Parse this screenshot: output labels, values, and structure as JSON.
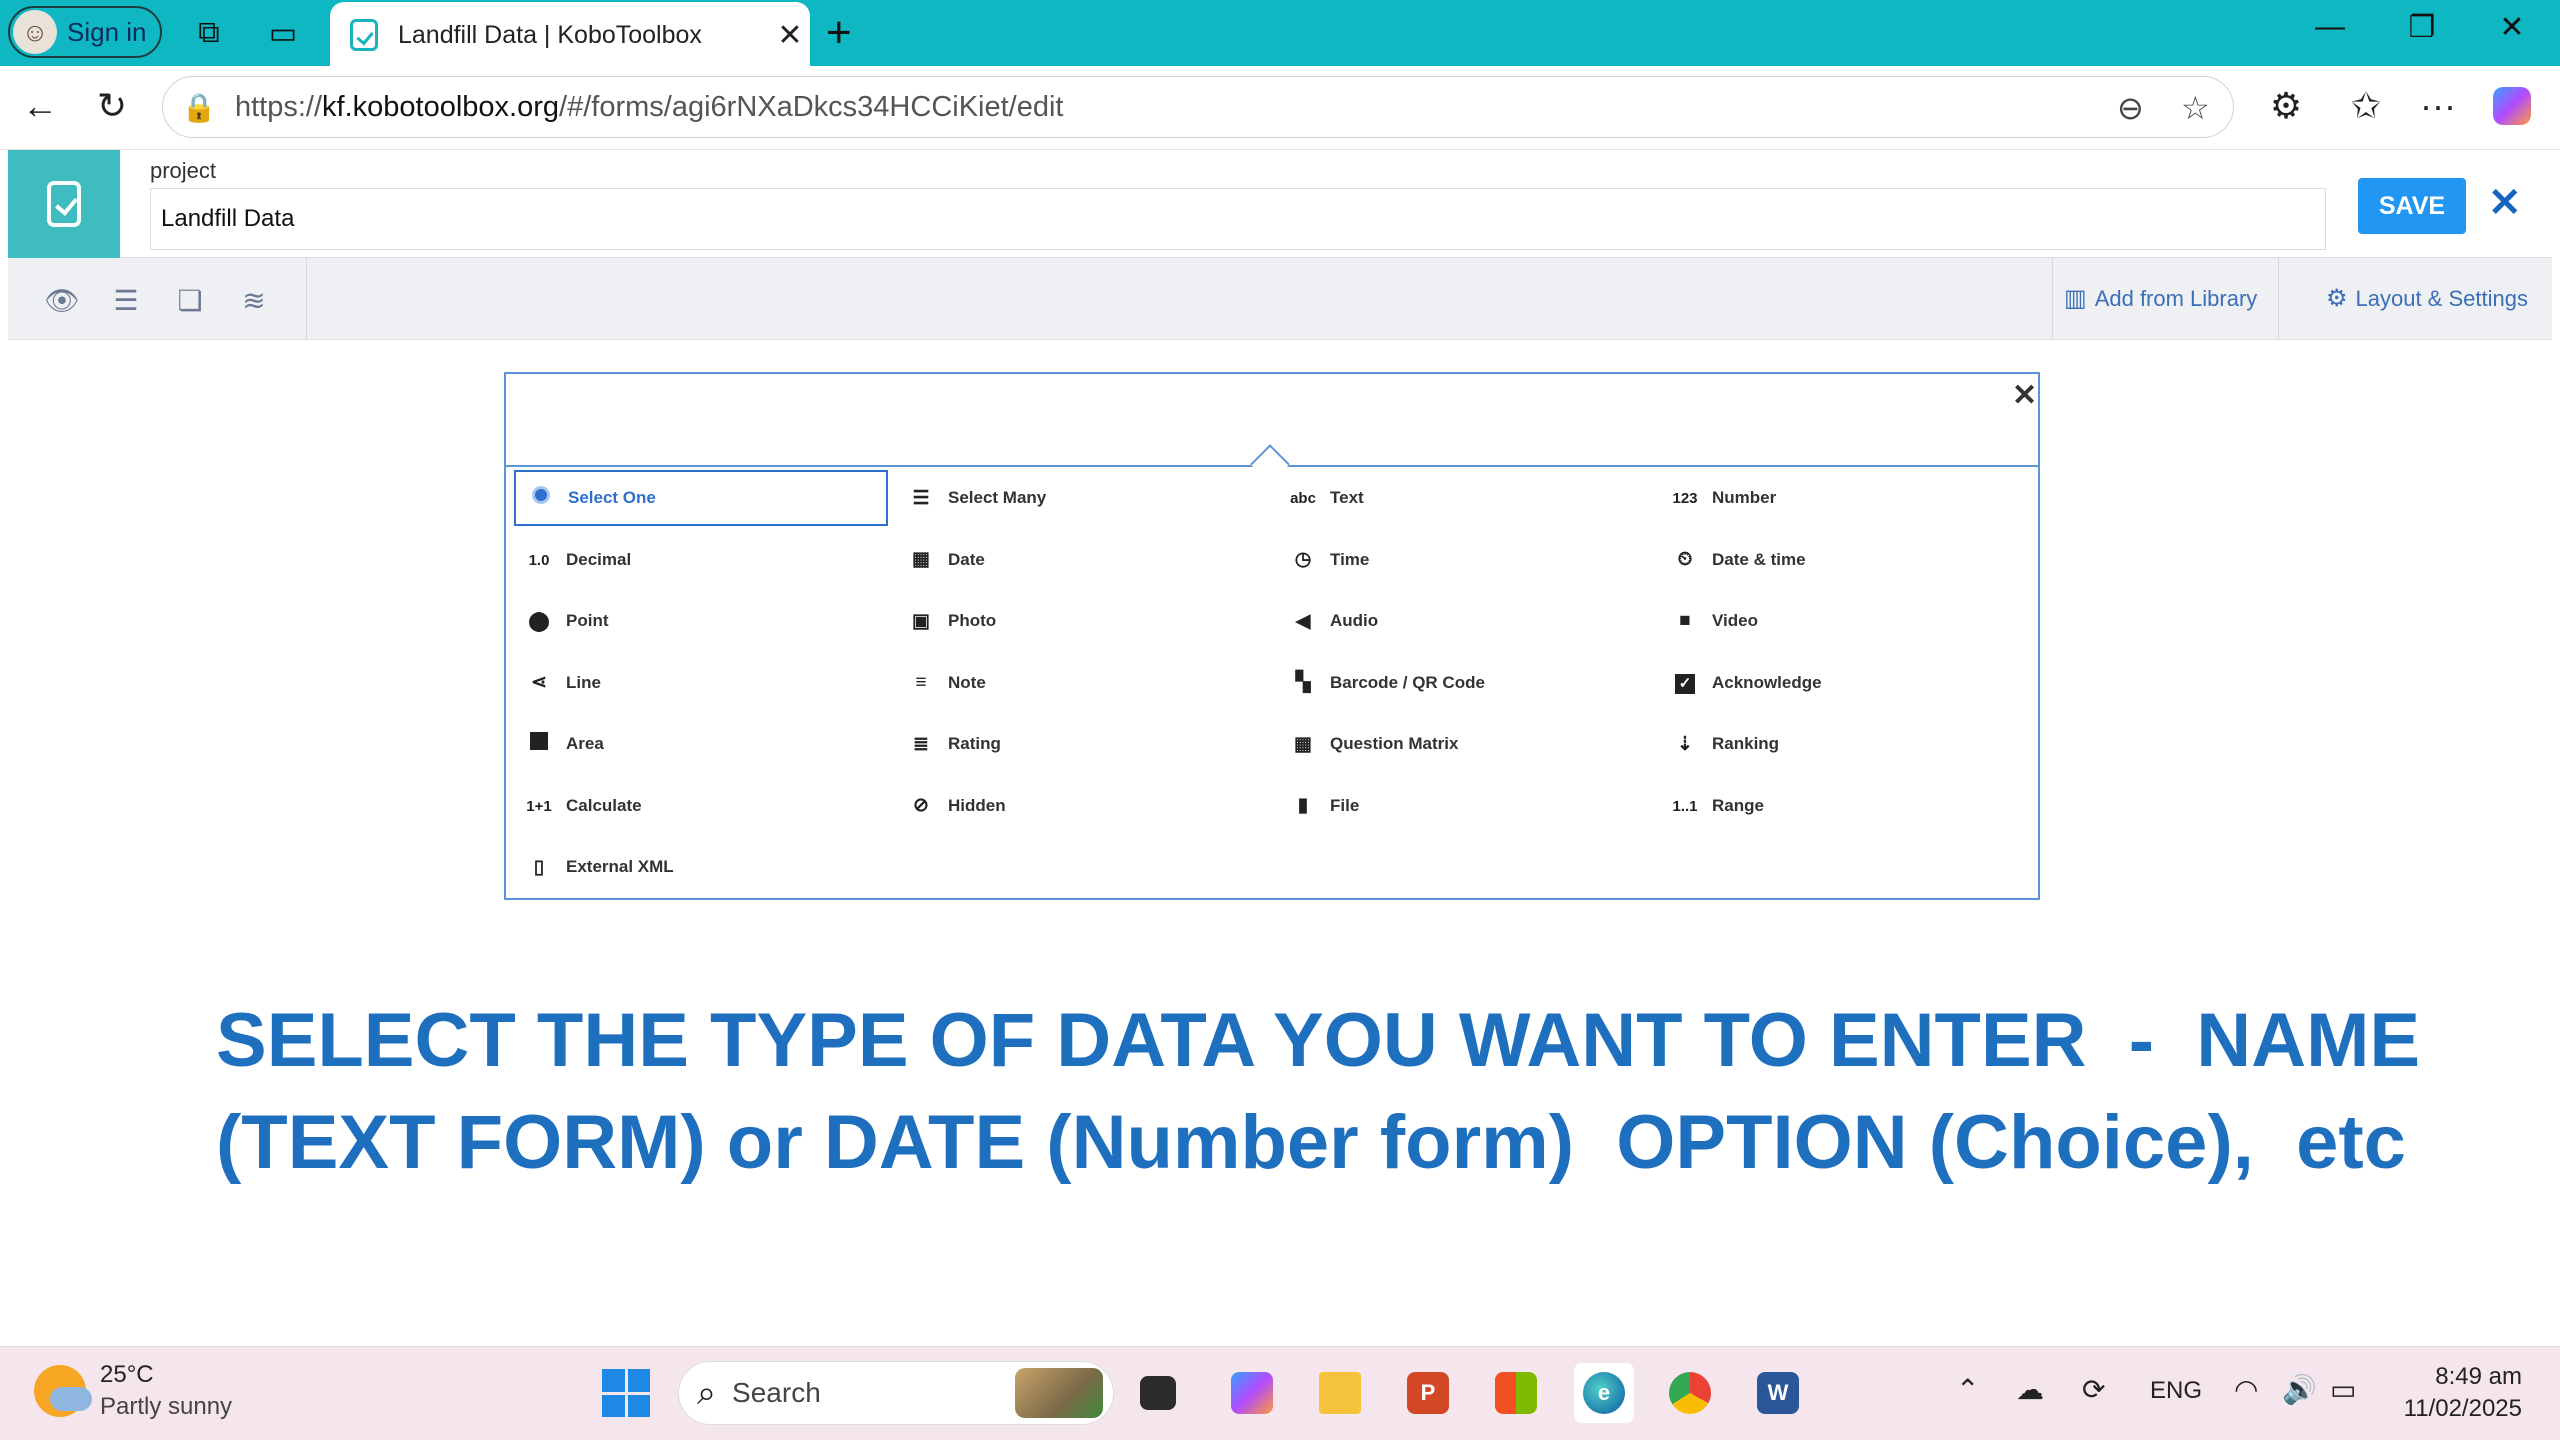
{
  "browser": {
    "profile_label": "Sign in",
    "tab_title": "Landfill Data | KoboToolbox",
    "url_scheme": "https://",
    "url_host": "kf.kobotoolbox.org",
    "url_path": "/#/forms/agi6rNXaDkcs34HCCiKiet/edit"
  },
  "kobo": {
    "project_label": "project",
    "project_name": "Landfill Data",
    "save_label": "SAVE",
    "add_library_label": "Add from Library",
    "layout_settings_label": "Layout & Settings"
  },
  "picker": {
    "types": [
      {
        "label": "Select One",
        "icon": "radio-icon"
      },
      {
        "label": "Select Many",
        "icon": "list-icon"
      },
      {
        "label": "Text",
        "icon": "abc"
      },
      {
        "label": "Number",
        "icon": "123"
      },
      {
        "label": "Decimal",
        "icon": "1.0"
      },
      {
        "label": "Date",
        "icon": "calendar-icon"
      },
      {
        "label": "Time",
        "icon": "clock-icon"
      },
      {
        "label": "Date & time",
        "icon": "datetime-icon"
      },
      {
        "label": "Point",
        "icon": "pin-icon"
      },
      {
        "label": "Photo",
        "icon": "photo-icon"
      },
      {
        "label": "Audio",
        "icon": "speaker-icon"
      },
      {
        "label": "Video",
        "icon": "video-icon"
      },
      {
        "label": "Line",
        "icon": "share-icon"
      },
      {
        "label": "Note",
        "icon": "lines-icon"
      },
      {
        "label": "Barcode / QR Code",
        "icon": "qr-icon"
      },
      {
        "label": "Acknowledge",
        "icon": "checkbox-icon"
      },
      {
        "label": "Area",
        "icon": "square-icon"
      },
      {
        "label": "Rating",
        "icon": "rating-icon"
      },
      {
        "label": "Question Matrix",
        "icon": "table-icon"
      },
      {
        "label": "Ranking",
        "icon": "sort-icon"
      },
      {
        "label": "Calculate",
        "icon": "1+1"
      },
      {
        "label": "Hidden",
        "icon": "eye-slash-icon"
      },
      {
        "label": "File",
        "icon": "file-icon"
      },
      {
        "label": "Range",
        "icon": "1..1"
      },
      {
        "label": "External XML",
        "icon": "xml-file-icon"
      }
    ],
    "selected": "Select One"
  },
  "caption": {
    "line1": "SELECT THE TYPE OF DATA YOU WANT TO ENTER  -  NAME",
    "line2": "(TEXT FORM) or DATE (Number form)  OPTION (Choice),  etc"
  },
  "taskbar": {
    "temperature": "25°C",
    "weather": "Partly sunny",
    "search_label": "Search",
    "language": "ENG",
    "time": "8:49 am",
    "date": "11/02/2025"
  },
  "colors": {
    "tabstrip": "#0fb7c3",
    "kobo_teal": "#3fbcbf",
    "save_blue": "#2196f3",
    "caption_blue": "#1f6fbf"
  }
}
